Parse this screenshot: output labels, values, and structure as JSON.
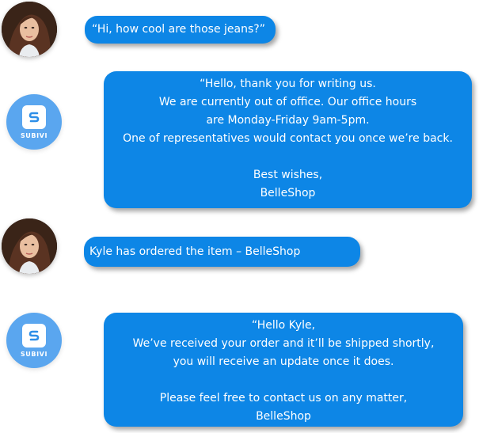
{
  "colors": {
    "bubble": "#0d86e6",
    "brand_badge": "#5aa6ef",
    "logo_tile": "#ffffff"
  },
  "icons": {
    "user_avatar": "woman-portrait-avatar",
    "brand_logo": "subivi-s-logo"
  },
  "brand": {
    "name": "SUBIVI"
  },
  "messages": [
    {
      "sender": "customer",
      "text": "“Hi, how cool are those jeans?”"
    },
    {
      "sender": "brand",
      "lines": [
        "“Hello, thank you for writing us.",
        "We are currently out of office. Our office hours",
        "are Monday-Friday 9am-5pm.",
        "One of representatives would contact you once we’re back.",
        "",
        "Best wishes,",
        "BelleShop"
      ]
    },
    {
      "sender": "customer",
      "text": "Kyle has ordered the item – BelleShop"
    },
    {
      "sender": "brand",
      "lines": [
        "“Hello Kyle,",
        "We’ve received your order and it’ll be shipped shortly,",
        "you will receive an update once it does.",
        "",
        "Please feel free to contact us on any matter,",
        "BelleShop"
      ]
    }
  ]
}
